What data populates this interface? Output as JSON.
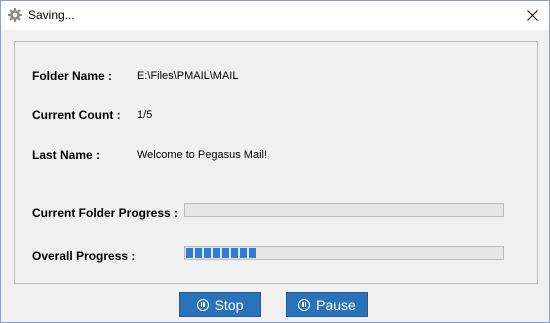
{
  "window": {
    "title": "Saving..."
  },
  "fields": {
    "folder_name_label": "Folder Name :",
    "folder_name_value": "E:\\Files\\PMAIL\\MAIL",
    "current_count_label": "Current Count :",
    "current_count_value": "1/5",
    "last_name_label": "Last Name :",
    "last_name_value": "Welcome to Pegasus Mail!"
  },
  "progress": {
    "current_folder_label": "Current Folder Progress :",
    "current_folder_fraction": 0,
    "overall_label": "Overall Progress :",
    "overall_fraction": 0.22
  },
  "buttons": {
    "stop_label": "Stop",
    "pause_label": "Pause"
  },
  "colors": {
    "button_bg": "#2b73b8",
    "progress_fill": "#2e7ed9"
  }
}
